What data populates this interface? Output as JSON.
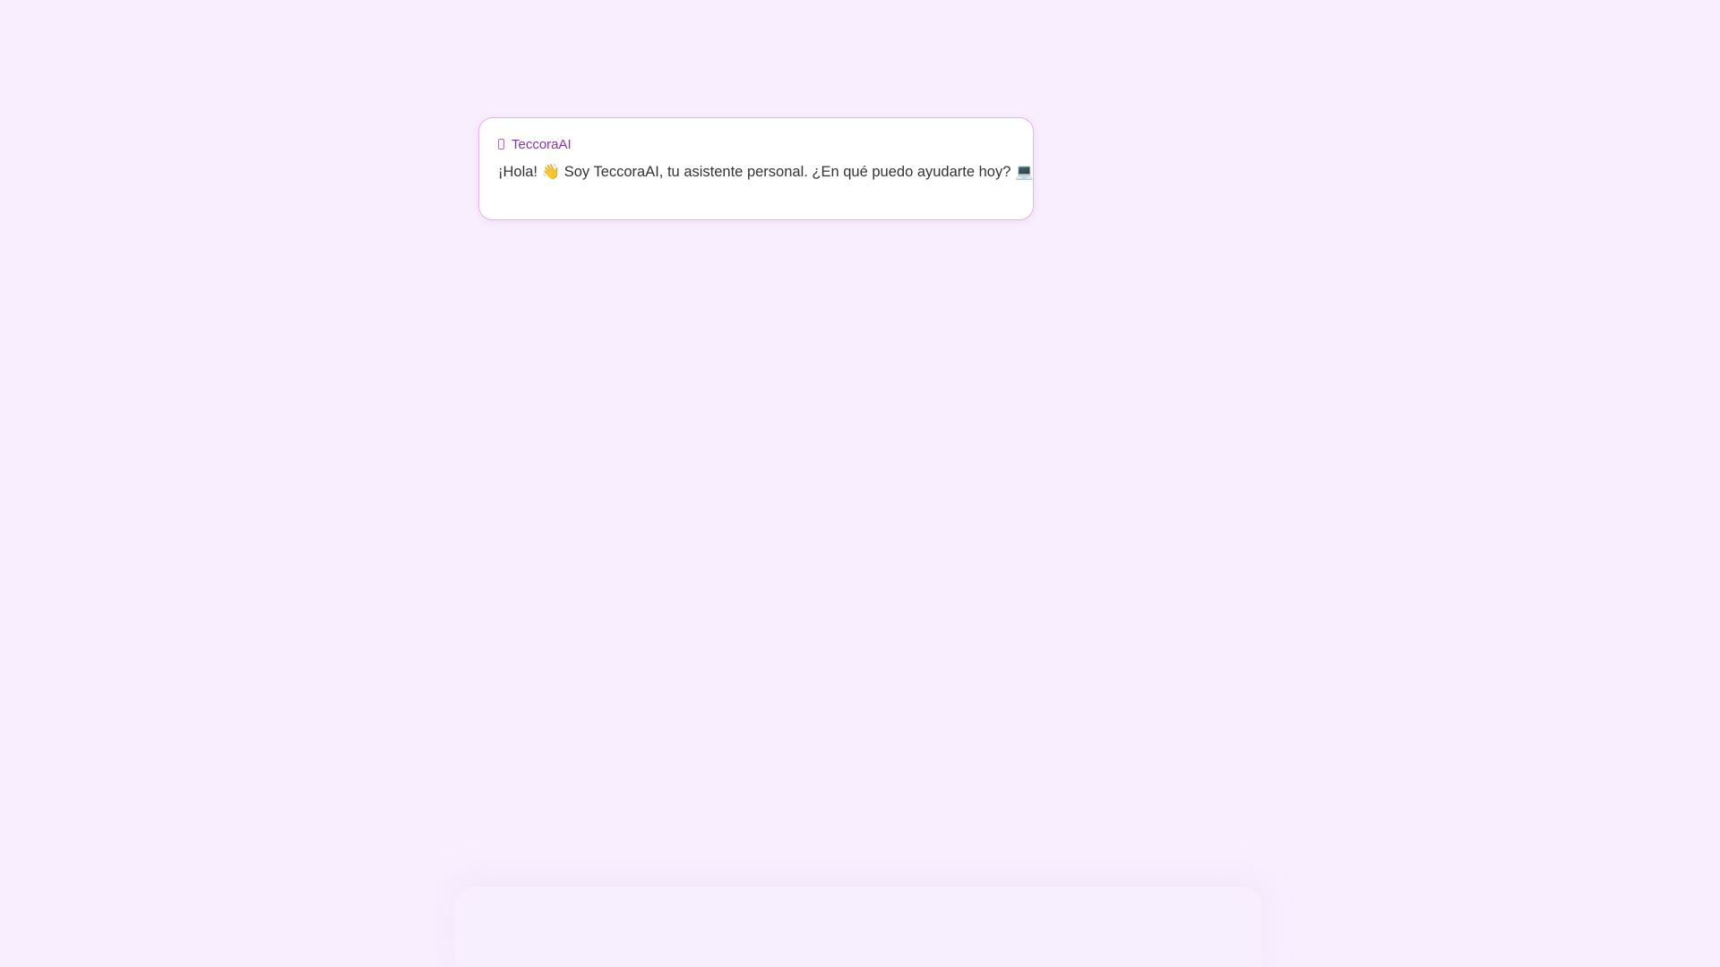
{
  "message": {
    "sender": "TeccoraAI",
    "text": "¡Hola! 👋 Soy TeccoraAI, tu asistente personal. ¿En qué puedo ayudarte hoy? 💻"
  },
  "colors": {
    "background": "#f8eefe",
    "bubble_border": "#e8b3f1",
    "sender_name": "#8a2fbf",
    "message_text": "#333333"
  },
  "icons": {
    "sender": "bot-icon"
  }
}
